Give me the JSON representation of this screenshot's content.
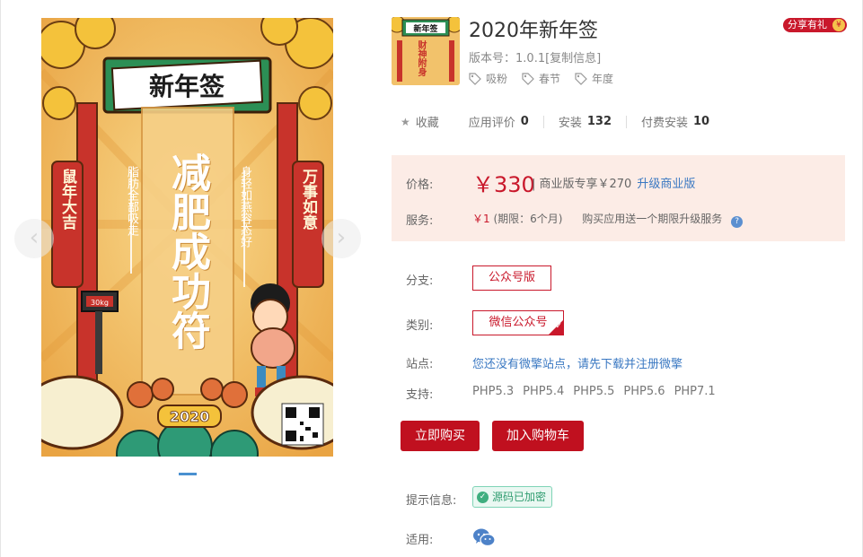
{
  "gallery": {
    "poster": {
      "banner": "新年签",
      "left_couplet": "鼠年大吉",
      "right_couplet": "万事如意",
      "main_text": "减肥成功符",
      "sub_left": "脂肪全部吸走",
      "sub_right": "身轻如燕容态好",
      "scale_text": "30kg",
      "year": "2020"
    },
    "prev_icon": "‹",
    "next_icon": "›"
  },
  "product": {
    "title": "2020年新年签",
    "version_label": "版本号：",
    "version": "1.0.1",
    "copy_info": "[复制信息]",
    "tags": [
      "吸粉",
      "春节",
      "年度"
    ],
    "thumb_banner": "新年签",
    "thumb_text": "财神附身",
    "share": "分享有礼",
    "share_badge": "¥"
  },
  "stats": {
    "favorite": "收藏",
    "rating_label": "应用评价",
    "rating": "0",
    "install_label": "安装",
    "install": "132",
    "paid_label": "付费安装",
    "paid": "10"
  },
  "price": {
    "label": "价格:",
    "value": "￥330",
    "business": "| 商业版专享￥270",
    "upgrade": "升级商业版"
  },
  "service": {
    "label": "服务:",
    "amount": "￥1",
    "period": "(期限：6个月)",
    "gift": "购买应用送一个期限升级服务",
    "help": "?"
  },
  "options": {
    "branch_label": "分支:",
    "branch": "公众号版",
    "category_label": "类别:",
    "category": "微信公众号",
    "site_label": "站点:",
    "site_text": "您还没有微擎站点，请先下载并注册微擎",
    "support_label": "支持:",
    "support": [
      "PHP5.3",
      "PHP5.4",
      "PHP5.5",
      "PHP5.6",
      "PHP7.1"
    ]
  },
  "actions": {
    "buy": "立即购买",
    "cart": "加入购物车"
  },
  "tips": {
    "label": "提示信息:",
    "badge": "源码已加密",
    "apply_label": "适用:"
  },
  "colors": {
    "accent_red": "#c0101f",
    "link_blue": "#3a78c2",
    "price_bg": "#fcece6",
    "badge_green": "#2e9c6f"
  }
}
